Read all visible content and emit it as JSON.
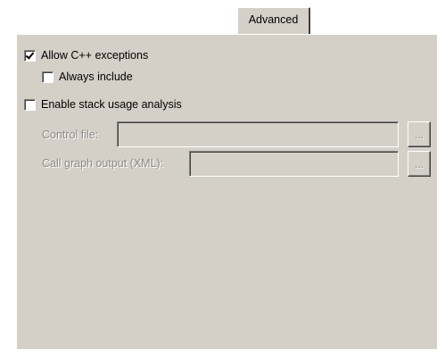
{
  "tabs": [
    {
      "label": "Advanced"
    }
  ],
  "options": {
    "allow_cpp_exceptions": {
      "label": "Allow C++ exceptions",
      "checked": true
    },
    "always_include": {
      "label": "Always include",
      "checked": false
    },
    "enable_stack_usage": {
      "label": "Enable stack usage analysis",
      "checked": false
    }
  },
  "control_file": {
    "label": "Control file:",
    "value": "",
    "browse_label": "..."
  },
  "call_graph_output": {
    "label": "Call graph output (XML):",
    "value": "",
    "browse_label": "..."
  }
}
